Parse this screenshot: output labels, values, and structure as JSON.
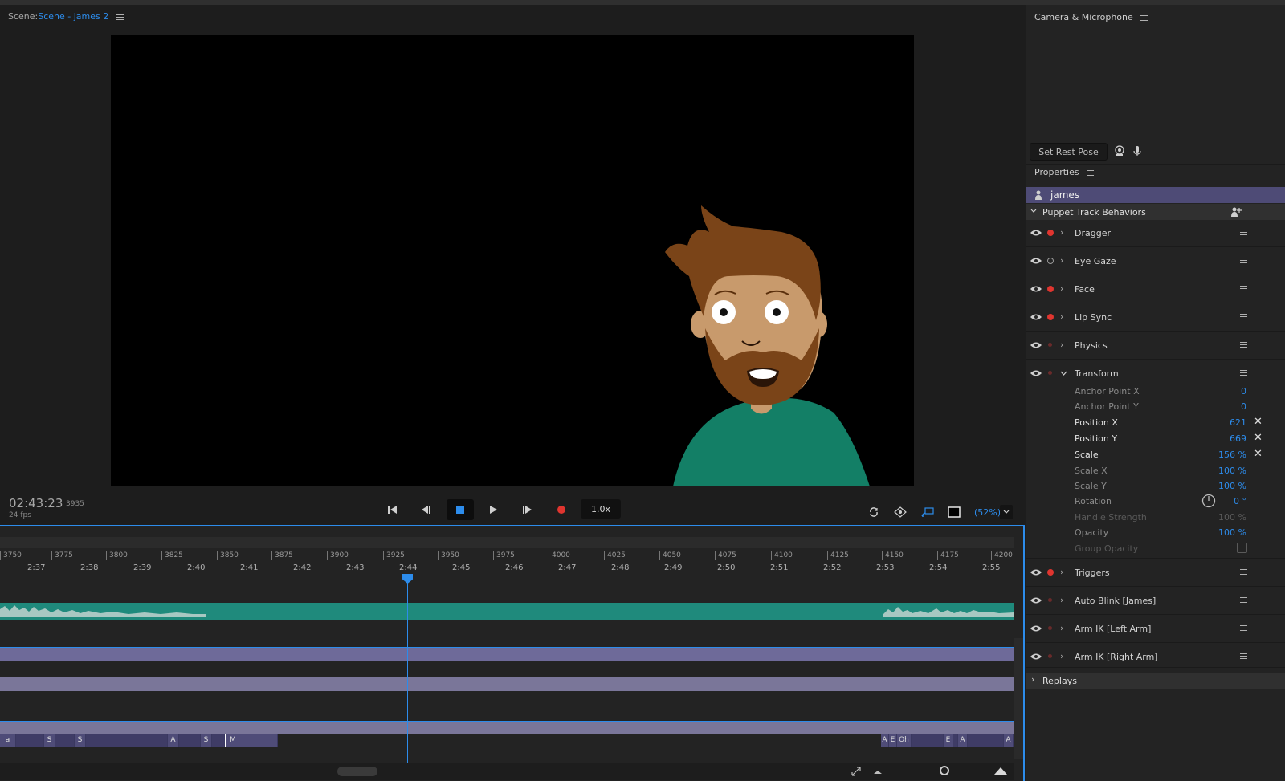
{
  "scene": {
    "label": "Scene:",
    "name": "Scene - james 2"
  },
  "transport": {
    "timecode": "02:43:23",
    "frame": "3935",
    "fps": "24 fps",
    "speed": "1.0x",
    "zoom": "(52%)"
  },
  "timeline": {
    "frame_ticks": [
      "3750",
      "3775",
      "3800",
      "3825",
      "3850",
      "3875",
      "3900",
      "3925",
      "3950",
      "3975",
      "4000",
      "4025",
      "4050",
      "4075",
      "4100",
      "4125",
      "4150",
      "4175",
      "4200"
    ],
    "time_ticks": [
      "2:37",
      "2:38",
      "2:39",
      "2:40",
      "2:41",
      "2:42",
      "2:43",
      "2:44",
      "2:45",
      "2:46",
      "2:47",
      "2:48",
      "2:49",
      "2:50",
      "2:51",
      "2:52",
      "2:53",
      "2:54",
      "2:55"
    ],
    "visemes_left": [
      "a",
      "S",
      "S",
      "A",
      "S",
      "M"
    ],
    "visemes_right": [
      "A",
      "E",
      "Oh",
      "E",
      "A",
      "A"
    ]
  },
  "camera_panel": {
    "title": "Camera & Microphone",
    "rest_pose_label": "Set Rest Pose"
  },
  "properties": {
    "title": "Properties",
    "puppet_name": "james",
    "section_title": "Puppet Track Behaviors",
    "behaviors": [
      {
        "name": "Dragger",
        "armed": "red"
      },
      {
        "name": "Eye Gaze",
        "armed": "hollow"
      },
      {
        "name": "Face",
        "armed": "red"
      },
      {
        "name": "Lip Sync",
        "armed": "red"
      },
      {
        "name": "Physics",
        "armed": "dim"
      },
      {
        "name": "Transform",
        "armed": "dim"
      },
      {
        "name": "Triggers",
        "armed": "red"
      },
      {
        "name": "Auto Blink [James]",
        "armed": "dim"
      },
      {
        "name": "Arm IK [Left Arm]",
        "armed": "dim"
      },
      {
        "name": "Arm IK [Right Arm]",
        "armed": "dim"
      }
    ],
    "transform_params": [
      {
        "name": "Anchor Point X",
        "value": "0",
        "dim": true
      },
      {
        "name": "Anchor Point Y",
        "value": "0",
        "dim": true
      },
      {
        "name": "Position X",
        "value": "621",
        "dim": false,
        "clear": true
      },
      {
        "name": "Position Y",
        "value": "669",
        "dim": false,
        "clear": true
      },
      {
        "name": "Scale",
        "value": "156 %",
        "dim": false,
        "clear": true
      },
      {
        "name": "Scale X",
        "value": "100 %",
        "dim": true
      },
      {
        "name": "Scale Y",
        "value": "100 %",
        "dim": true
      },
      {
        "name": "Rotation",
        "value": "0 °",
        "dim": true
      },
      {
        "name": "Handle Strength",
        "value": "100 %",
        "dim": true,
        "disabled": true
      },
      {
        "name": "Opacity",
        "value": "100 %",
        "dim": true
      },
      {
        "name": "Group Opacity",
        "value": "",
        "dim": true,
        "disabled": true
      }
    ],
    "replays_label": "Replays"
  },
  "colors": {
    "accent": "#2d8ceb",
    "record": "#e0352f",
    "track_teal": "#1f8a7c",
    "track_purple": "#7a7699"
  }
}
